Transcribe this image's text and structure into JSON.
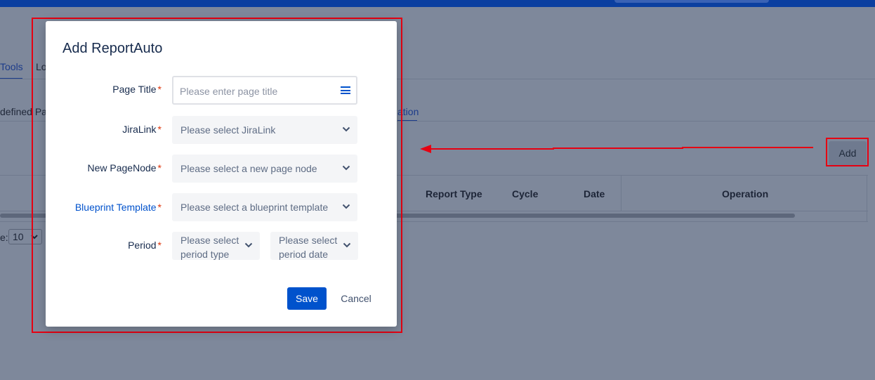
{
  "background": {
    "tabs": [
      {
        "label": "Tools"
      },
      {
        "label": "Lo"
      }
    ],
    "subtabs": [
      {
        "label": "defined Pa"
      },
      {
        "label": "ation"
      }
    ],
    "add_button_label": "Add",
    "table": {
      "columns": [
        "Report Type",
        "Cycle",
        "Date",
        "Operation"
      ]
    },
    "pagination": {
      "size_label": "e:",
      "page_size_value": "10"
    }
  },
  "modal": {
    "title": "Add ReportAuto",
    "fields": {
      "page_title": {
        "label": "Page Title",
        "required_mark": "*",
        "placeholder": "Please enter page title"
      },
      "jira_link": {
        "label": "JiraLink",
        "required_mark": "*",
        "placeholder": "Please select JiraLink"
      },
      "new_page_node": {
        "label": "New PageNode",
        "required_mark": "*",
        "placeholder": "Please select a new page node"
      },
      "blueprint_template": {
        "label": "Blueprint Template",
        "required_mark": "*",
        "placeholder": "Please select a blueprint template"
      },
      "period": {
        "label": "Period",
        "required_mark": "*",
        "type_placeholder": "Please select period type",
        "date_placeholder": "Please select period date"
      }
    },
    "save_label": "Save",
    "cancel_label": "Cancel"
  },
  "icons": {
    "field_menu": "hamburger-menu-icon",
    "select_chevron": "chevron-down-icon",
    "annotation_arrow": "arrow-left-icon"
  },
  "colors": {
    "primary": "#0052cc",
    "required": "#de350b",
    "annotation": "#e60012",
    "overlay": "#7e889b",
    "topbar": "#0b3fa0"
  }
}
